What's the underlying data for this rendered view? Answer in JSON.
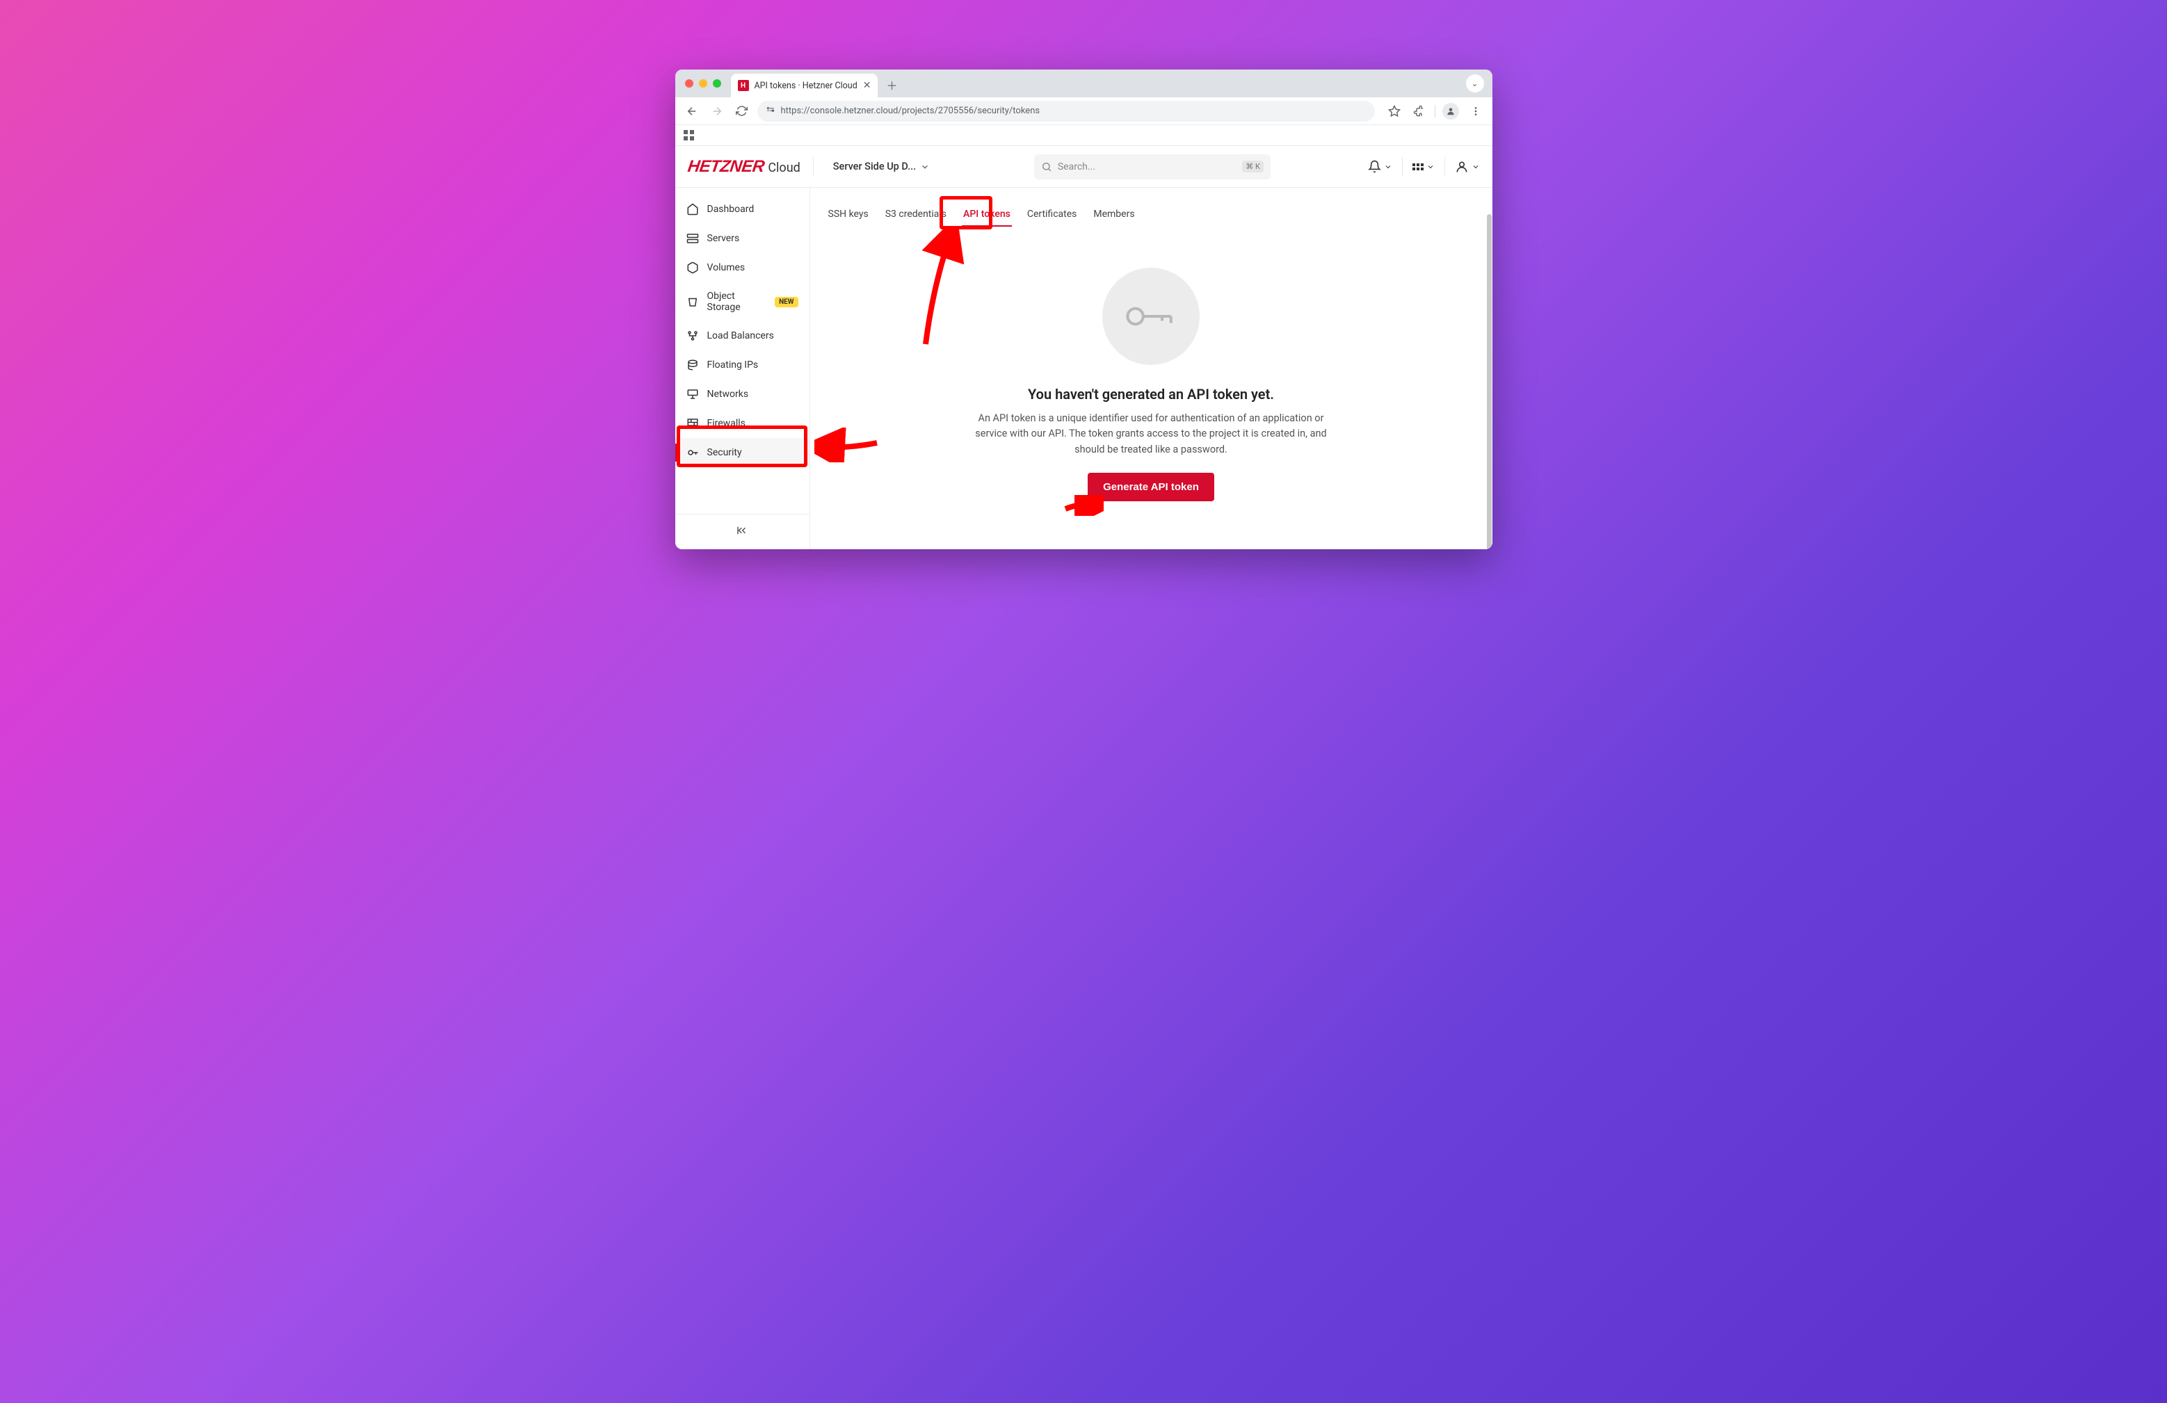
{
  "browser": {
    "tab_title": "API tokens · Hetzner Cloud",
    "url_display": "https://console.hetzner.cloud/projects/2705556/security/tokens",
    "url_host": "console.hetzner.cloud",
    "url_path": "/projects/2705556/security/tokens"
  },
  "header": {
    "logo": "HETZNER",
    "logo_sub": "Cloud",
    "project_name": "Server Side Up D...",
    "search_placeholder": "Search...",
    "search_shortcut": "⌘ K"
  },
  "sidebar": {
    "items": [
      {
        "label": "Dashboard",
        "icon": "home"
      },
      {
        "label": "Servers",
        "icon": "server"
      },
      {
        "label": "Volumes",
        "icon": "volume"
      },
      {
        "label": "Object Storage",
        "icon": "bucket",
        "badge": "NEW"
      },
      {
        "label": "Load Balancers",
        "icon": "balance"
      },
      {
        "label": "Floating IPs",
        "icon": "floating"
      },
      {
        "label": "Networks",
        "icon": "network"
      },
      {
        "label": "Firewalls",
        "icon": "firewall"
      },
      {
        "label": "Security",
        "icon": "key",
        "active": true
      }
    ]
  },
  "tabs": {
    "items": [
      {
        "label": "SSH keys"
      },
      {
        "label": "S3 credentials"
      },
      {
        "label": "API tokens",
        "active": true
      },
      {
        "label": "Certificates"
      },
      {
        "label": "Members"
      }
    ]
  },
  "empty": {
    "title": "You haven't generated an API token yet.",
    "description": "An API token is a unique identifier used for authentication of an application or service with our API. The token grants access to the project it is created in, and should be treated like a password.",
    "button": "Generate API token"
  }
}
